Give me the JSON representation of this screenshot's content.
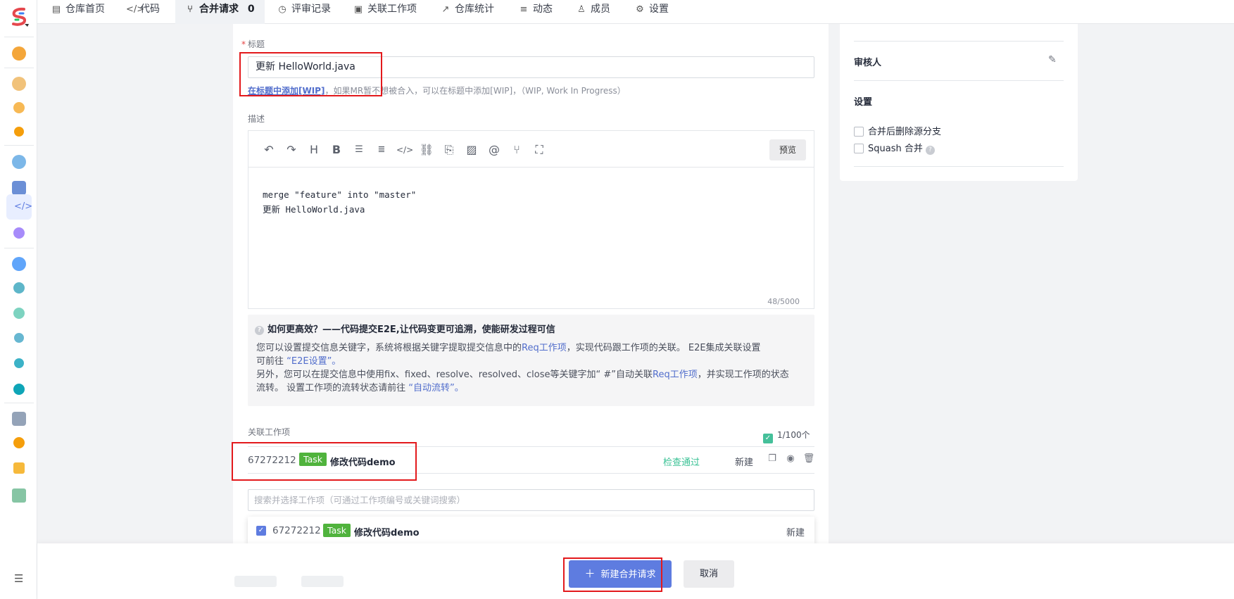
{
  "tabs": [
    {
      "label": "仓库首页",
      "icon": "repo-home-icon"
    },
    {
      "label": "代码",
      "icon": "code-icon"
    },
    {
      "label": "合并请求",
      "count": "0",
      "icon": "merge-request-icon"
    },
    {
      "label": "评审记录",
      "icon": "review-icon"
    },
    {
      "label": "关联工作项",
      "icon": "workitem-icon"
    },
    {
      "label": "仓库统计",
      "icon": "stats-icon"
    },
    {
      "label": "动态",
      "icon": "activity-icon"
    },
    {
      "label": "成员",
      "icon": "member-icon"
    },
    {
      "label": "设置",
      "icon": "gear-icon"
    }
  ],
  "form": {
    "title_label": "标题",
    "title_value": "更新 HelloWorld.java",
    "wip_link": "在标题中添加[WIP]",
    "wip_hint": "，如果MR暂不想被合入，可以在标题中添加[WIP]，（WIP, Work In Progress）",
    "desc_label": "描述",
    "preview_label": "预览",
    "desc_lines": [
      "merge \"feature\" into \"master\"",
      "更新 HelloWorld.java"
    ],
    "char_count": "48/5000"
  },
  "tip": {
    "title": "如何更高效？——代码提交E2E,让代码变更可追溯，使能研发过程可信",
    "l1a": "您可以设置提交信息关键字，系统将根据关键字提取提交信息中的",
    "l1link": "Req工作项",
    "l1b": "，实现代码跟工作项的关联。 E2E集成关联设置",
    "l2a": "可前往 ",
    "l2link": "“E2E设置”。",
    "l3a": "另外，您可以在提交信息中使用fix、fixed、resolve、resolved、close等关键字加“ #”自动关联",
    "l3link": "Req工作项",
    "l3b": "，并实现工作项的状态",
    "l4a": "流转。 设置工作项的流转状态请前往 ",
    "l4link": "“自动流转”。"
  },
  "related": {
    "label": "关联工作项",
    "count": "1/100个",
    "item": {
      "id": "67272212",
      "type": "Task",
      "title": "修改代码demo",
      "check_status": "检查通过",
      "state": "新建"
    },
    "search_placeholder": "搜索并选择工作项（可通过工作项编号或关键词搜索）",
    "dropdown_item": {
      "id": "67272212",
      "type": "Task",
      "title": "修改代码demo",
      "state": "新建"
    }
  },
  "side": {
    "reviewer_label": "审核人",
    "settings_label": "设置",
    "opt_delete_branch": "合并后删除源分支",
    "opt_squash": "Squash 合并"
  },
  "footer": {
    "create_label": "新建合并请求",
    "cancel_label": "取消"
  },
  "colors": {
    "primary": "#5e7ce0",
    "task_tag": "#50b33d",
    "pass": "#3ac295",
    "highlight": "#e3191c"
  }
}
